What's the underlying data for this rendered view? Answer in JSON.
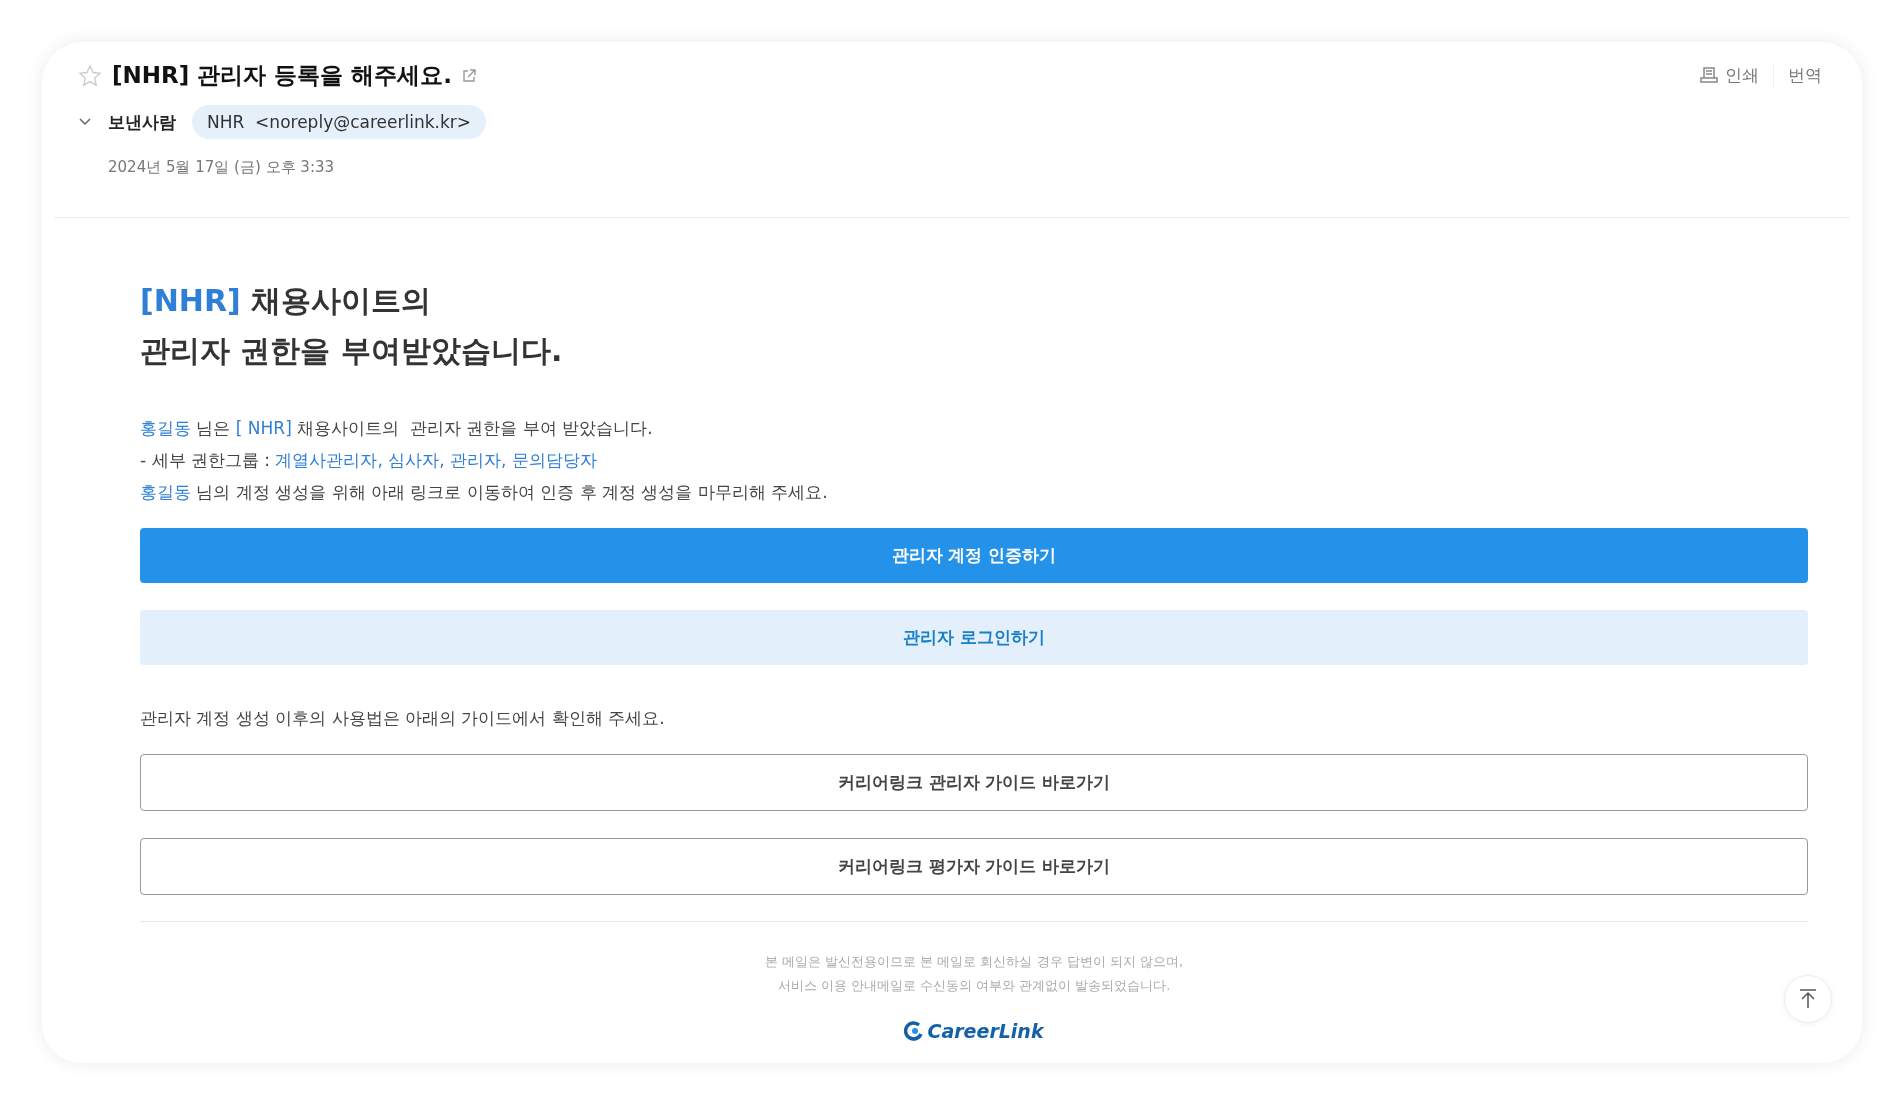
{
  "header": {
    "starred": false,
    "subject": "[NHR] 관리자 등록을 해주세요.",
    "actions": [
      "인쇄",
      "번역"
    ],
    "sender_label": "보낸사람",
    "sender_expanded": false,
    "sender_name": "NHR",
    "sender_address": "<noreply@careerlink.kr>",
    "date": "2024년 5월 17일 (금) 오후 3:33"
  },
  "body": {
    "heading": [
      [
        {
          "text": "[NHR]",
          "highlight": true
        },
        {
          "text": " 채용사이트의",
          "highlight": false
        }
      ],
      [
        {
          "text": "관리자 권한을 부여받았습니다.",
          "highlight": false
        }
      ]
    ],
    "paragraphs": [
      [
        {
          "text": "홍길동",
          "highlight": true
        },
        {
          "text": " 님은 ",
          "highlight": false
        },
        {
          "text": "[ NHR]",
          "highlight": true
        },
        {
          "text": " 채용사이트의  관리자 권한을 부여 받았습니다.",
          "highlight": false
        }
      ],
      [
        {
          "text": "- 세부 권한그룹 : ",
          "highlight": false
        },
        {
          "text": "계열사관리자, 심사자, 관리자, 문의담당자",
          "highlight": true
        }
      ],
      [
        {
          "text": "홍길동",
          "highlight": true
        },
        {
          "text": " 님의 계정 생성을 위해 아래 링크로 이동하여 인증 후 계정 생성을 마무리해 주세요.",
          "highlight": false
        }
      ]
    ],
    "buttons": [
      {
        "label": "관리자 계정 인증하기",
        "kind": "primary"
      },
      {
        "label": "관리자 로그인하기",
        "kind": "secondary"
      }
    ],
    "guide_text": "관리자 계정 생성 이후의 사용법은 아래의 가이드에서 확인해 주세요.",
    "guide_buttons": [
      {
        "label": "커리어링크 관리자 가이드 바로가기",
        "kind": "outline"
      },
      {
        "label": "커리어링크 평가자 가이드 바로가기",
        "kind": "outline"
      }
    ],
    "footer_notice": [
      "본 메일은 발신전용이므로 본 메일로 회신하실 경우 답변이 되지 않으며,",
      "서비스 이용 안내메일로 수신동의 여부와 관계없이 발송되었습니다."
    ],
    "logo": "CareerLink"
  }
}
